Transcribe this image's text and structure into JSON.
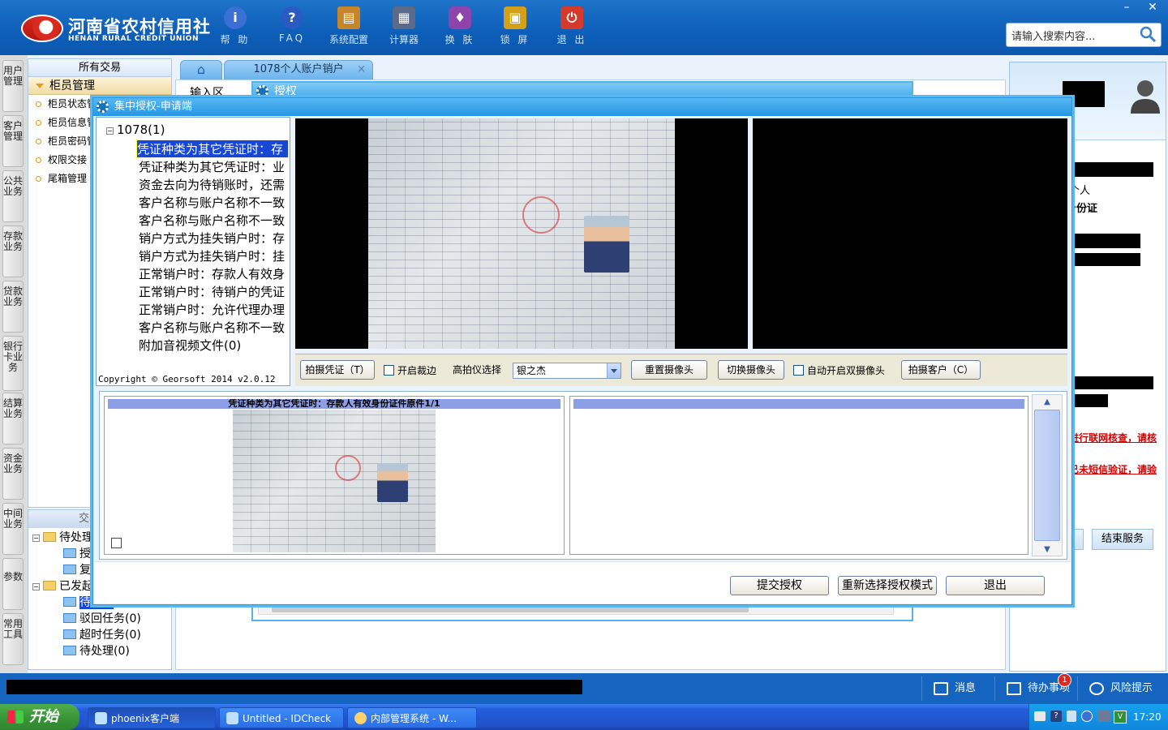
{
  "brand": {
    "cn": "河南省农村信用社",
    "en": "HENAN RURAL CREDIT UNION"
  },
  "toolbar": [
    {
      "label": "帮 助",
      "icon": "info-icon",
      "color": "#3b6fd6"
    },
    {
      "label": "FAQ",
      "icon": "question-icon",
      "color": "#2a5bc2"
    },
    {
      "label": "系统配置",
      "icon": "toolbox-icon",
      "color": "#c7852a"
    },
    {
      "label": "计算器",
      "icon": "calculator-icon",
      "color": "#5a6a8a"
    },
    {
      "label": "换 肤",
      "icon": "shirt-icon",
      "color": "#8e44ad"
    },
    {
      "label": "锁 屏",
      "icon": "lock-icon",
      "color": "#d4a017"
    },
    {
      "label": "退 出",
      "icon": "power-icon",
      "color": "#d63a2a"
    }
  ],
  "search": {
    "placeholder": "请输入搜索内容..."
  },
  "window_controls": {
    "minimize": "–",
    "close": "✕"
  },
  "left_rail": [
    "用户管理",
    "客户管理",
    "公共业务",
    "存款业务",
    "贷款业务",
    "银行卡业务",
    "结算业务",
    "资金业务",
    "中间业务",
    "参数",
    "常用工具"
  ],
  "nav": {
    "all": "所有交易",
    "group": "柜员管理",
    "items": [
      "柜员状态管理",
      "柜员信息管理",
      "柜员密码管理",
      "权限交接",
      "尾箱管理"
    ]
  },
  "tx_info": {
    "header": "交易信息",
    "nodes": [
      "待处理",
      "授权",
      "复核",
      "已发起",
      "待处理",
      "驳回任务(0)",
      "超时任务(0)",
      "待处理(0)"
    ]
  },
  "tabs": {
    "home": "⌂",
    "active": "1078个人账户销户",
    "close": "×"
  },
  "main": {
    "input_zone": "输入区",
    "auth_title": "授权"
  },
  "dialog": {
    "title": "集中授权-申请端",
    "tree_root": "1078(1)",
    "tree_items": [
      "凭证种类为其它凭证时：存",
      "凭证种类为其它凭证时：业",
      "资金去向为待销账时，还需",
      "客户名称与账户名称不一致",
      "客户名称与账户名称不一致",
      "销户方式为挂失销户时：存",
      "销户方式为挂失销户时：挂",
      "正常销户时：存款人有效身",
      "正常销户时：待销户的凭证",
      "正常销户时：允许代理办理",
      "客户名称与账户名称不一致",
      "附加音视频文件(0)"
    ],
    "copyright": "Copyright © Georsoft 2014 v2.0.12",
    "buttons": {
      "capture_voucher": "拍摄凭证（T）",
      "crop": "开启裁边",
      "camera_select_label": "高拍仪选择",
      "camera_value": "银之杰",
      "reset_camera": "重置摄像头",
      "switch_camera": "切换摄像头",
      "auto_dual": "自动开启双摄像头",
      "capture_customer": "拍摄客户（C）"
    },
    "panel1_caption": "凭证种类为其它凭证时：存款人有效身份证件原件1/1",
    "panel2_caption": "",
    "footer": {
      "submit": "提交授权",
      "reselect": "重新选择授权模式",
      "exit": "退出"
    }
  },
  "right_panel": {
    "type_label": "个人",
    "id_label": "身份证",
    "warn1": "进行联网核查，请核",
    "warn2": "已未短信验证，请验",
    "end_service": "结束服务"
  },
  "status_bar": {
    "messages": "消息",
    "todo": "待办事项",
    "todo_count": "1",
    "risk": "风险提示"
  },
  "taskbar": {
    "start": "开始",
    "tasks": [
      "phoenix客户端",
      "Untitled - IDCheck",
      "内部管理系统 - W..."
    ],
    "clock": "17:20"
  }
}
